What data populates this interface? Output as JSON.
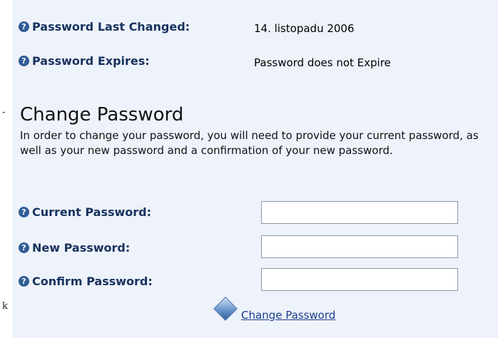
{
  "page_edge_marks": {
    "top": "-",
    "bottom": "k"
  },
  "info": {
    "last_changed_label": "Password Last Changed:",
    "last_changed_value": "14. listopadu 2006",
    "expires_label": "Password Expires:",
    "expires_value": "Password does not Expire"
  },
  "change": {
    "title": "Change Password",
    "description": "In order to change your password, you will need to provide your current password, as well as your new password and a confirmation of your new password.",
    "current_label": "Current Password:",
    "current_value": "",
    "new_label": "New Password:",
    "new_value": "",
    "confirm_label": "Confirm Password:",
    "confirm_value": "",
    "submit_link": "Change Password"
  },
  "icons": {
    "help": "question-circle-icon",
    "submit": "blue-diamond-icon"
  },
  "colors": {
    "panel_bg": "#eef2fa",
    "label_text": "#17325e",
    "help_icon": "#2f5d95",
    "link": "#1a3f8f"
  }
}
